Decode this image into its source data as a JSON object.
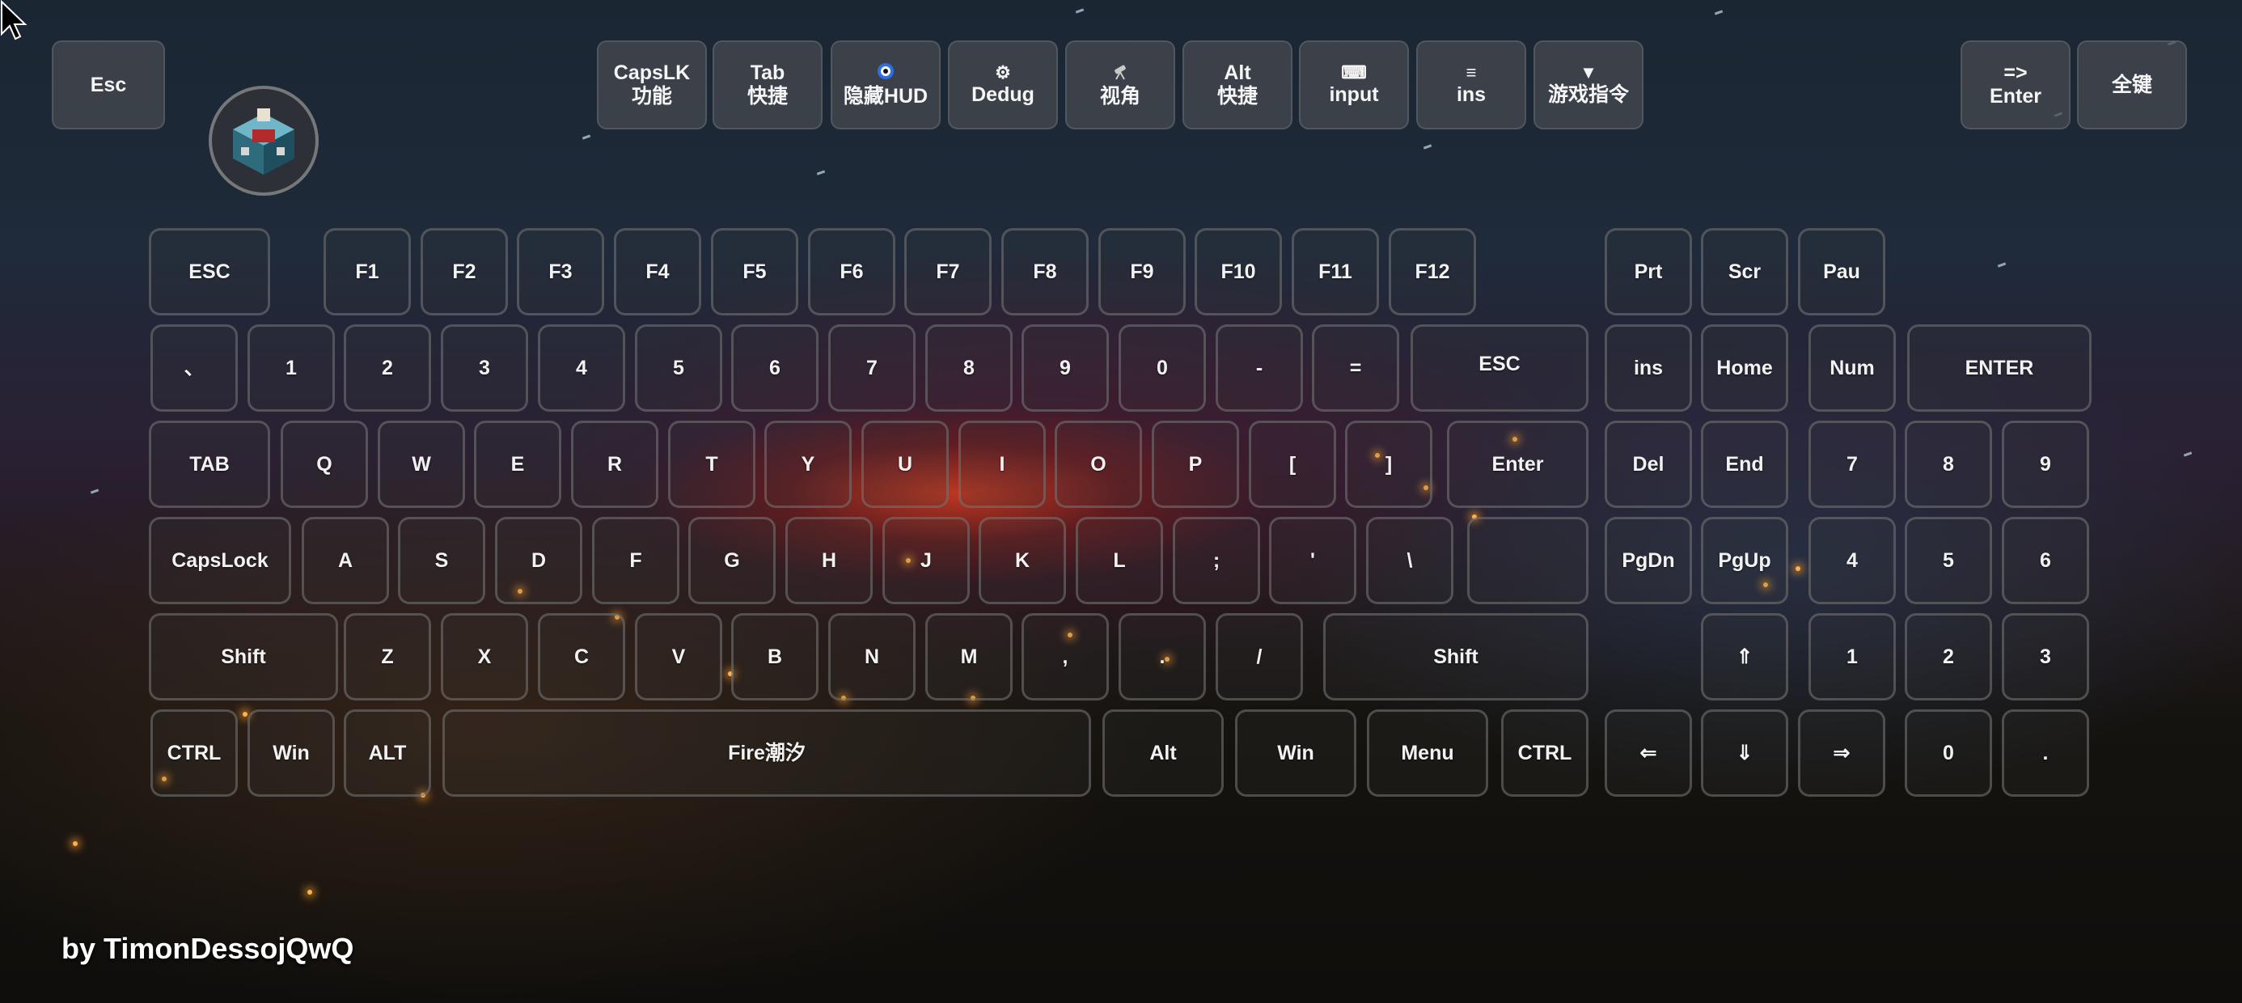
{
  "toolbar": {
    "esc": "Esc",
    "capslk": [
      "CapsLK",
      "功能"
    ],
    "tab": [
      "Tab",
      "快捷"
    ],
    "hud": "隐藏HUD",
    "dedug": "Dedug",
    "view": "视角",
    "alt": [
      "Alt",
      "快捷"
    ],
    "input": "input",
    "ins": "ins",
    "cmd": "游戏指令",
    "enter": [
      "=>",
      "Enter"
    ],
    "allkeys": "全键",
    "icons": {
      "hud": "eye-icon",
      "dedug": "gear-icon",
      "view": "telescope-icon",
      "input": "keyboard-icon",
      "ins": "menu-icon",
      "cmd": "triangle-down-icon"
    }
  },
  "keyboard": {
    "fn_row": [
      "ESC",
      "F1",
      "F2",
      "F3",
      "F4",
      "F5",
      "F6",
      "F7",
      "F8",
      "F9",
      "F10",
      "F11",
      "F12"
    ],
    "sys_row": [
      "Prt",
      "Scr",
      "Pau"
    ],
    "num_row": [
      "、",
      "1",
      "2",
      "3",
      "4",
      "5",
      "6",
      "7",
      "8",
      "9",
      "0",
      "-",
      "=",
      "ESC"
    ],
    "nav1": [
      "ins",
      "Home"
    ],
    "pad1": [
      "Num",
      "ENTER"
    ],
    "q_row": [
      "TAB",
      "Q",
      "W",
      "E",
      "R",
      "T",
      "Y",
      "U",
      "I",
      "O",
      "P",
      "[",
      "]",
      "Enter"
    ],
    "nav2": [
      "Del",
      "End"
    ],
    "pad2": [
      "7",
      "8",
      "9"
    ],
    "a_row": [
      "CapsLock",
      "A",
      "S",
      "D",
      "F",
      "G",
      "H",
      "J",
      "K",
      "L",
      ";",
      "'",
      "\\",
      ""
    ],
    "nav3": [
      "PgDn",
      "PgUp"
    ],
    "pad3": [
      "4",
      "5",
      "6"
    ],
    "z_row": [
      "Shift",
      "Z",
      "X",
      "C",
      "V",
      "B",
      "N",
      "M",
      ",",
      ".",
      "/",
      "Shift"
    ],
    "nav4": [
      "⇑"
    ],
    "pad4": [
      "1",
      "2",
      "3"
    ],
    "bottom_row": [
      "CTRL",
      "Win",
      "ALT",
      "Fire潮汐",
      "Alt",
      "Win",
      "Menu",
      "CTRL"
    ],
    "nav5": [
      "⇐",
      "⇓",
      "⇒"
    ],
    "pad5": [
      "0",
      "."
    ]
  },
  "footer": "by TimonDessojQwQ",
  "colors": {
    "key_border": "#7a7a7a",
    "toolbar_bg": "#46494f",
    "sunset": "#d23c1e"
  }
}
